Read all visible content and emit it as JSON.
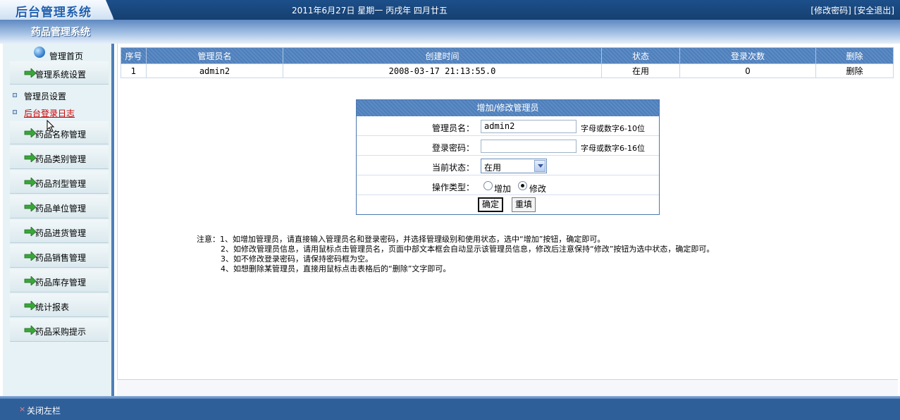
{
  "header": {
    "logo": "后台管理系统",
    "date": "2011年6月27日 星期一 丙戌年 四月廿五",
    "change_password": "[修改密码]",
    "logout": "[安全退出]"
  },
  "system_name": "药品管理系统",
  "sidebar": {
    "home": "管理首页",
    "section": "管理系统设置",
    "sub_items": [
      {
        "label": "管理员设置"
      },
      {
        "label": "后台登录日志"
      }
    ],
    "items": [
      {
        "label": "药品名称管理"
      },
      {
        "label": "药品类别管理"
      },
      {
        "label": "药品剂型管理"
      },
      {
        "label": "药品单位管理"
      },
      {
        "label": "药品进货管理"
      },
      {
        "label": "药品销售管理"
      },
      {
        "label": "药品库存管理"
      },
      {
        "label": "统计报表"
      },
      {
        "label": "药品采购提示"
      }
    ]
  },
  "table": {
    "columns": [
      "序号",
      "管理员名",
      "创建时间",
      "状态",
      "登录次数",
      "删除"
    ],
    "rows": [
      {
        "id": "1",
        "name": "admin2",
        "created": "2008-03-17 21:13:55.0",
        "status": "在用",
        "logins": "0",
        "delete": "删除"
      }
    ]
  },
  "form": {
    "title": "增加/修改管理员",
    "name_label": "管理员名：",
    "name_value": "admin2",
    "name_hint": "字母或数字6-10位",
    "password_label": "登录密码：",
    "password_value": "",
    "password_hint": "字母或数字6-16位",
    "status_label": "当前状态：",
    "status_value": "在用",
    "op_label": "操作类型：",
    "op_add": "增加",
    "op_edit": "修改",
    "submit": "确定",
    "reset": "重填"
  },
  "notes": [
    "注意：1、如增加管理员，请直接输入管理员名和登录密码，并选择管理级别和使用状态，选中“增加”按钮，确定即可。",
    "2、如修改管理员信息，请用鼠标点击管理员名，页面中部文本框会自动显示该管理员信息，修改后注意保持“修改”按钮为选中状态，确定即可。",
    "3、如不修改登录密码，请保持密码框为空。",
    "4、如想删除某管理员，直接用鼠标点击表格后的“删除”文字即可。"
  ],
  "footer": {
    "close_icon": "×",
    "close_label": "关闭左栏"
  },
  "colors": {
    "header_bg": "#1c4f8a",
    "sidebar_bg": "#e6f2f6",
    "table_header": "#4e7fbb",
    "footer_bg": "#2f5f98",
    "active_link": "#cc0000"
  }
}
